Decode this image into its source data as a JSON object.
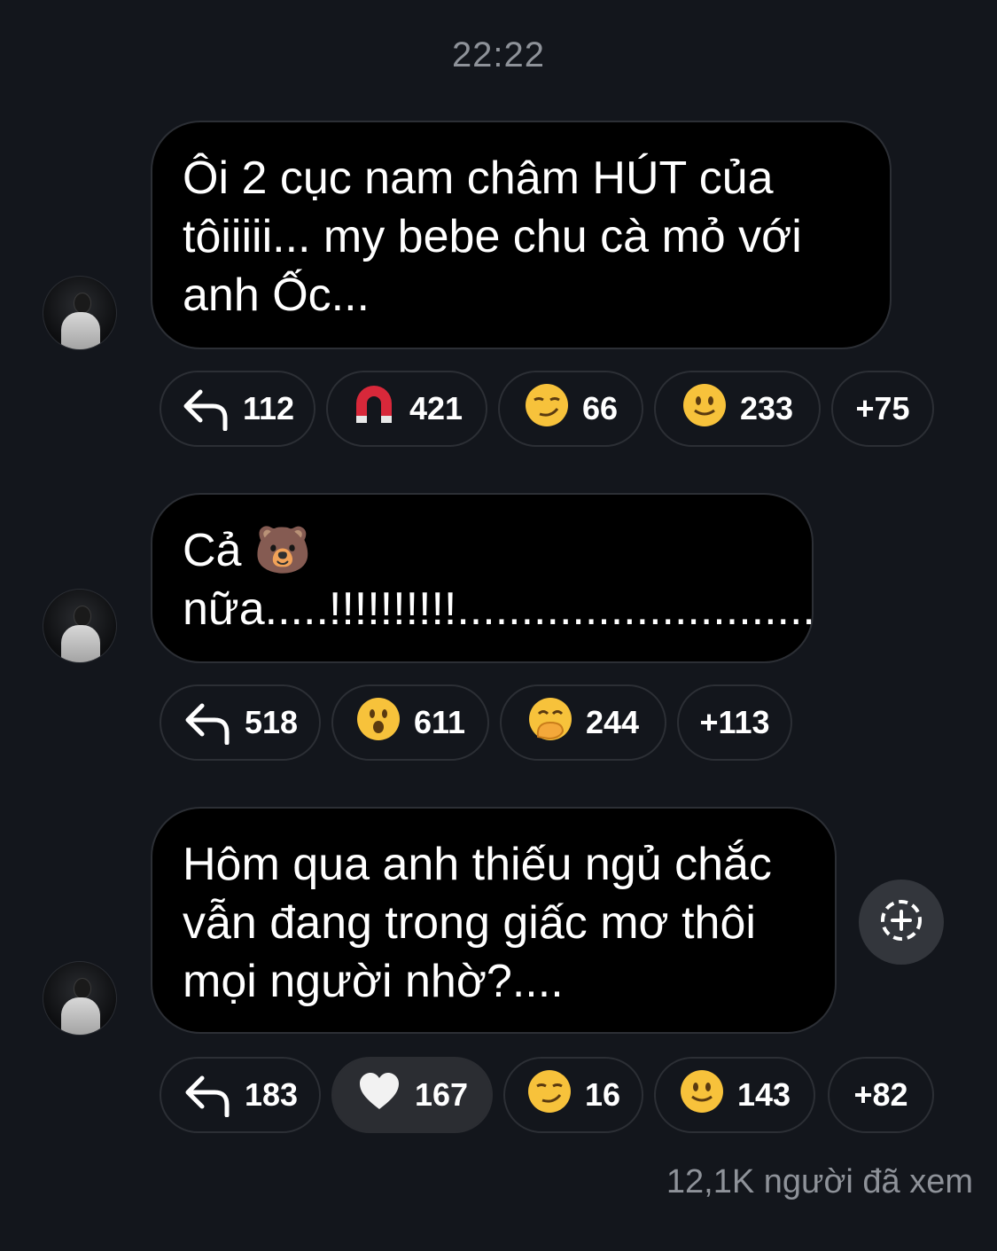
{
  "timestamp": "22:22",
  "messages": [
    {
      "lines": [
        "Ôi 2 cục nam châm HÚT của",
        "tôiiiii... my bebe chu cà mỏ với",
        "anh Ốc..."
      ],
      "reactions": [
        {
          "icon": "reply-icon",
          "emoji": "",
          "count": "112"
        },
        {
          "icon": "magnet-icon",
          "emoji": "🧲",
          "count": "421"
        },
        {
          "icon": "smirk-emoji",
          "emoji": "😏",
          "count": "66"
        },
        {
          "icon": "smile-emoji",
          "emoji": "🙂",
          "count": "233"
        },
        {
          "icon": "",
          "emoji": "",
          "count": "+75"
        }
      ]
    },
    {
      "lines": [
        "Cả 🐻",
        "nữa.....!!!!!!!!!!............................"
      ],
      "reactions": [
        {
          "icon": "reply-icon",
          "emoji": "",
          "count": "518"
        },
        {
          "icon": "surprised-emoji",
          "emoji": "😮",
          "count": "611"
        },
        {
          "icon": "hand-over-mouth-emoji",
          "emoji": "🤭",
          "count": "244"
        },
        {
          "icon": "",
          "emoji": "",
          "count": "+113"
        }
      ]
    },
    {
      "lines": [
        "Hôm qua anh thiếu ngủ chắc",
        "vẫn đang trong giấc mơ thôi",
        "mọi người nhờ?...."
      ],
      "reactions": [
        {
          "icon": "reply-icon",
          "emoji": "",
          "count": "183"
        },
        {
          "icon": "white-heart-emoji",
          "emoji": "🤍",
          "count": "167"
        },
        {
          "icon": "smirk-emoji",
          "emoji": "😏",
          "count": "16"
        },
        {
          "icon": "smile-emoji",
          "emoji": "🙂",
          "count": "143"
        },
        {
          "icon": "",
          "emoji": "",
          "count": "+82"
        }
      ]
    }
  ],
  "views": "12,1K người đã xem",
  "colors": {
    "background": "#13161c",
    "bubble": "#000000",
    "border": "#2c2f35",
    "muted_text": "#8e9299",
    "active_chip": "#2b2d32"
  }
}
